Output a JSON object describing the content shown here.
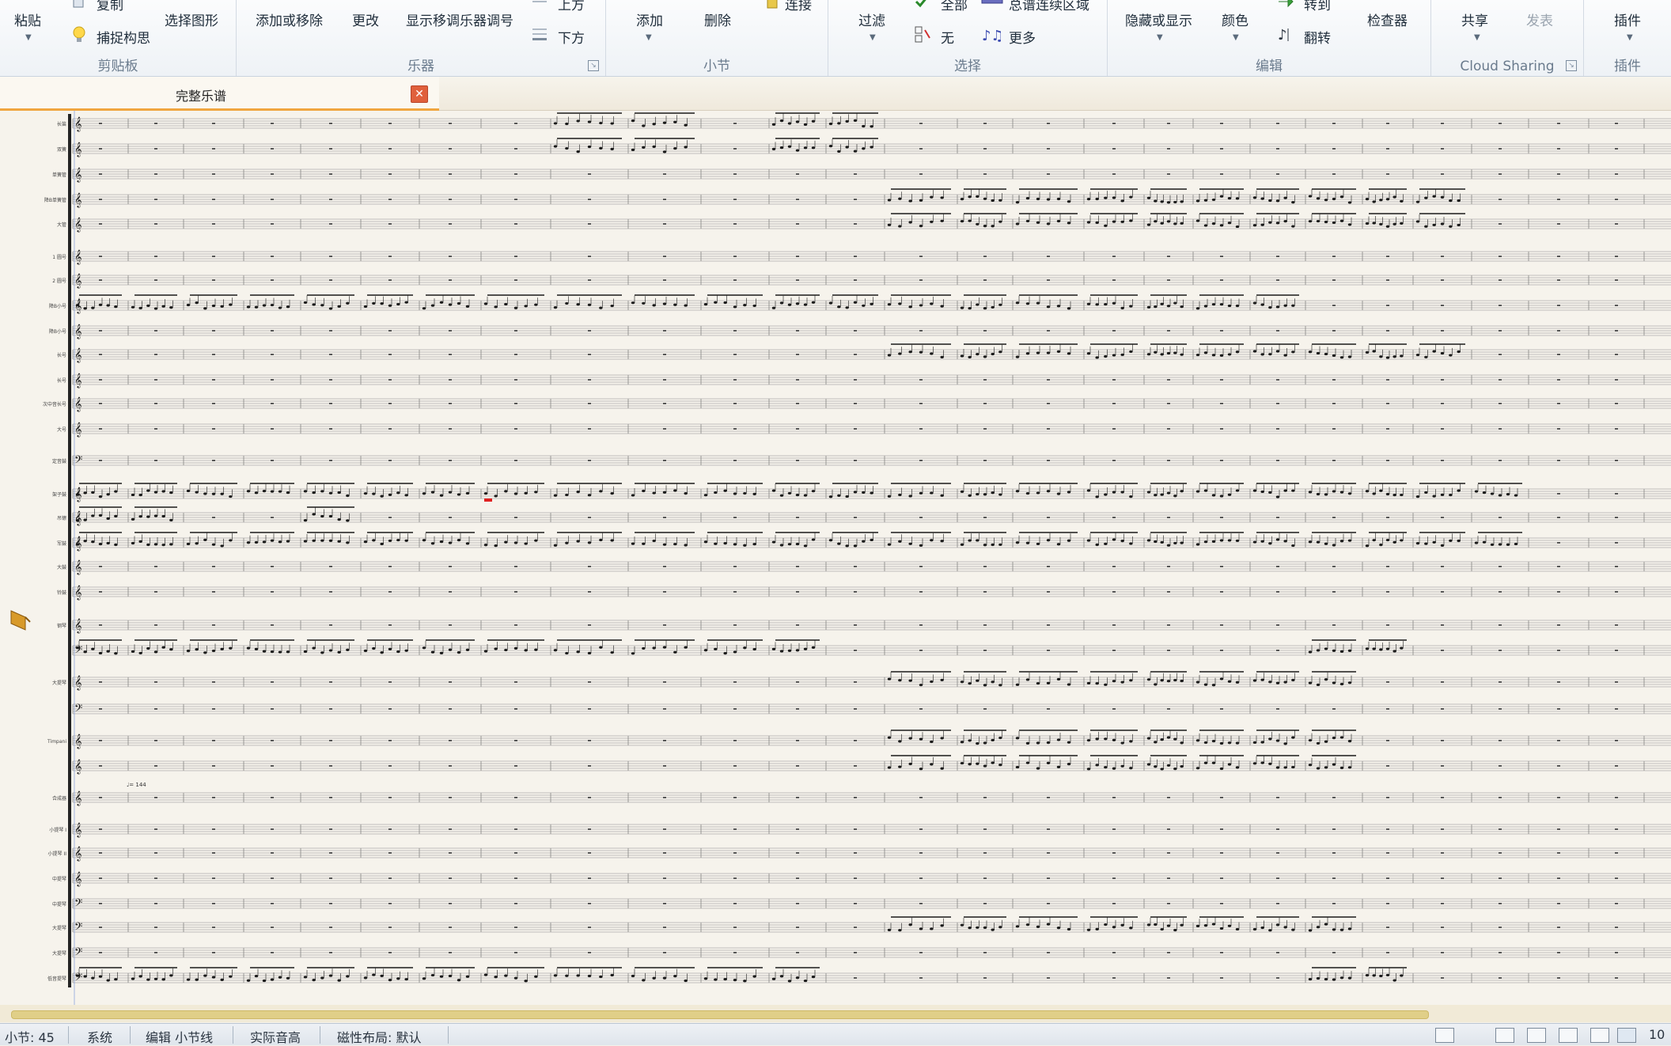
{
  "ribbon": {
    "clipboard": {
      "title": "剪贴板",
      "paste": "粘贴",
      "copy": "复制",
      "capture_idea": "捕捉构思",
      "select_graphic": "选择图形"
    },
    "instruments": {
      "title": "乐器",
      "add_remove": "添加或移除",
      "change": "更改",
      "show_transposing": "显示移调乐器调号",
      "above": "上方",
      "below": "下方"
    },
    "bars": {
      "title": "小节",
      "add": "添加",
      "delete": "删除",
      "join": "连接"
    },
    "select": {
      "title": "选择",
      "filter": "过滤",
      "all": "全部",
      "system_passage": "总谱连续区域",
      "none": "无",
      "more": "更多"
    },
    "edit": {
      "title": "编辑",
      "hide_show": "隐藏或显示",
      "color": "颜色",
      "go_to": "转到",
      "flip": "翻转",
      "inspector": "检查器"
    },
    "sharing": {
      "title": "Cloud Sharing",
      "share": "共享",
      "publish": "发表"
    },
    "plugins": {
      "title": "插件",
      "plugins_btn": "插件"
    }
  },
  "document_tab": {
    "label": "完整乐谱"
  },
  "score": {
    "tempo_mark": "♩= 144",
    "staff_labels": [
      "长笛",
      "双簧",
      "单簧管",
      "降B单簧管",
      "大管",
      "1 圆号",
      "2 圆号",
      "降B小号",
      "降B小号",
      "长号",
      "长号",
      "次中音长号",
      "大号",
      "定音鼓",
      "架子鼓",
      "吊镲",
      "军鼓",
      "大鼓",
      "铃鼓",
      "钢琴",
      "",
      "大提琴",
      "",
      "Timpani",
      "",
      "合成器",
      "小提琴 I",
      "小提琴 II",
      "中提琴",
      "中提琴",
      "大提琴",
      "大提琴",
      "低音提琴"
    ],
    "colors": {
      "paper": "#f6f3ec",
      "staff_line": "#8a8a8a",
      "note": "#1a1a1a",
      "selected_note": "#e02020"
    }
  },
  "status_bar": {
    "bar_count": "小节: 45",
    "system": "系统",
    "edit_mode": "编辑 小节线",
    "concert_pitch": "实际音高",
    "layout": "磁性布局: 默认",
    "zoom": "10"
  }
}
